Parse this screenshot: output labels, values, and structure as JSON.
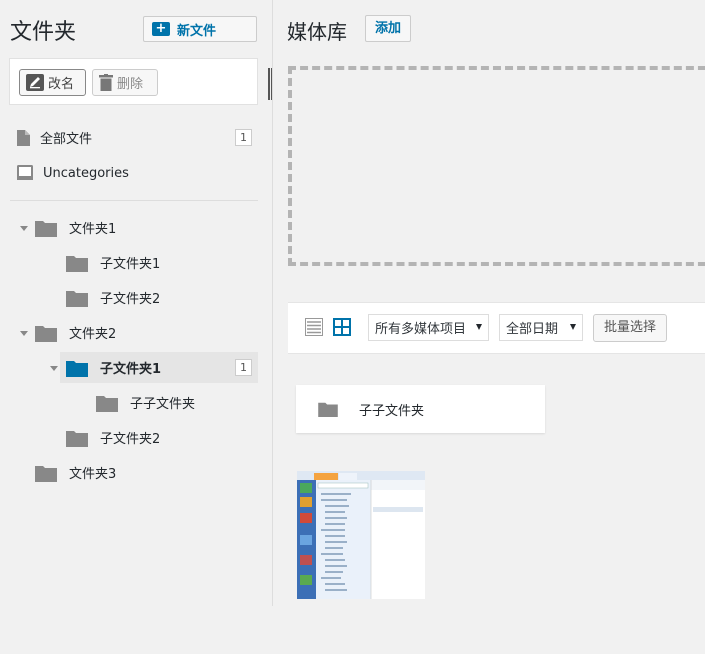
{
  "sidebar": {
    "title": "文件夹",
    "new_folder_label": "新文件",
    "rename_label": "改名",
    "delete_label": "删除",
    "all_files": {
      "label": "全部文件",
      "count": "1"
    },
    "uncategorized": {
      "label": "Uncategories"
    },
    "tree": [
      {
        "label": "文件夹1"
      },
      {
        "label": "子文件夹1"
      },
      {
        "label": "子文件夹2"
      },
      {
        "label": "文件夹2"
      },
      {
        "label": "子文件夹1",
        "count": "1"
      },
      {
        "label": "子子文件夹"
      },
      {
        "label": "子文件夹2"
      },
      {
        "label": "文件夹3"
      }
    ]
  },
  "main": {
    "title": "媒体库",
    "add_label": "添加",
    "filter_type": "所有多媒体项目",
    "filter_date": "全部日期",
    "bulk_select_label": "批量选择",
    "subfolder_card_label": "子子文件夹"
  },
  "colors": {
    "accent": "#0073aa",
    "folder_gray": "#888888",
    "selected_bg": "#e5e5e5"
  },
  "icons": [
    "plus-folder-icon",
    "pencil-icon",
    "trash-icon",
    "file-icon",
    "inbox-icon",
    "folder-icon",
    "list-view-icon",
    "grid-view-icon"
  ]
}
